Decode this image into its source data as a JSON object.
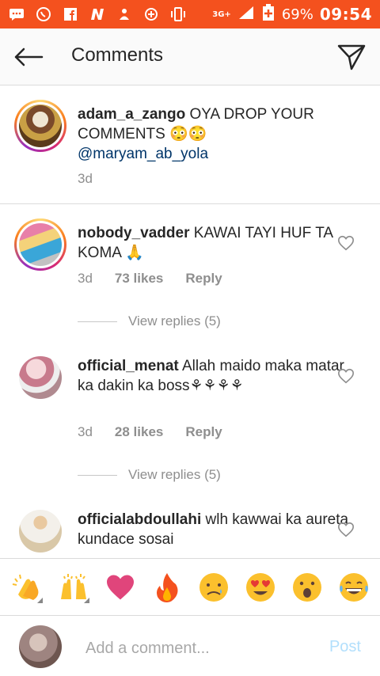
{
  "status_bar": {
    "battery": "69%",
    "time": "09:54",
    "network": "3G+",
    "icons": [
      "message-icon",
      "whatsapp-icon",
      "facebook-icon",
      "n-app-icon",
      "person-icon",
      "sync-icon",
      "vibrate-icon",
      "signal-icon",
      "battery-icon"
    ]
  },
  "app_bar": {
    "title": "Comments"
  },
  "caption": {
    "username": "adam_a_zango",
    "text": "OYA DROP YOUR COMMENTS 😳😳",
    "mention": "@maryam_ab_yola",
    "time": "3d"
  },
  "comments": [
    {
      "username": "nobody_vadder",
      "text": "KAWAI TAYI HUF TA KOMA 🙏",
      "time": "3d",
      "likes": "73 likes",
      "reply_label": "Reply",
      "view_replies": "View replies (5)"
    },
    {
      "username": "official_menat",
      "text": "Allah maido maka matar ka dakin ka boss⚘⚘⚘⚘",
      "time": "3d",
      "likes": "28 likes",
      "reply_label": "Reply",
      "view_replies": "View replies (5)"
    },
    {
      "username": "officialabdoullahi",
      "text": "wlh kawwai ka aureta kundace sosai"
    }
  ],
  "emoji_bar": [
    "👏",
    "🙌",
    "❤️",
    "🔥",
    "😥",
    "😍",
    "😮",
    "😂"
  ],
  "composer": {
    "placeholder": "Add a comment...",
    "post_label": "Post"
  },
  "colors": {
    "status_bar": "#f4511e",
    "mention": "#003569",
    "muted": "#8e8e8e",
    "post_disabled": "#b2dffc"
  }
}
